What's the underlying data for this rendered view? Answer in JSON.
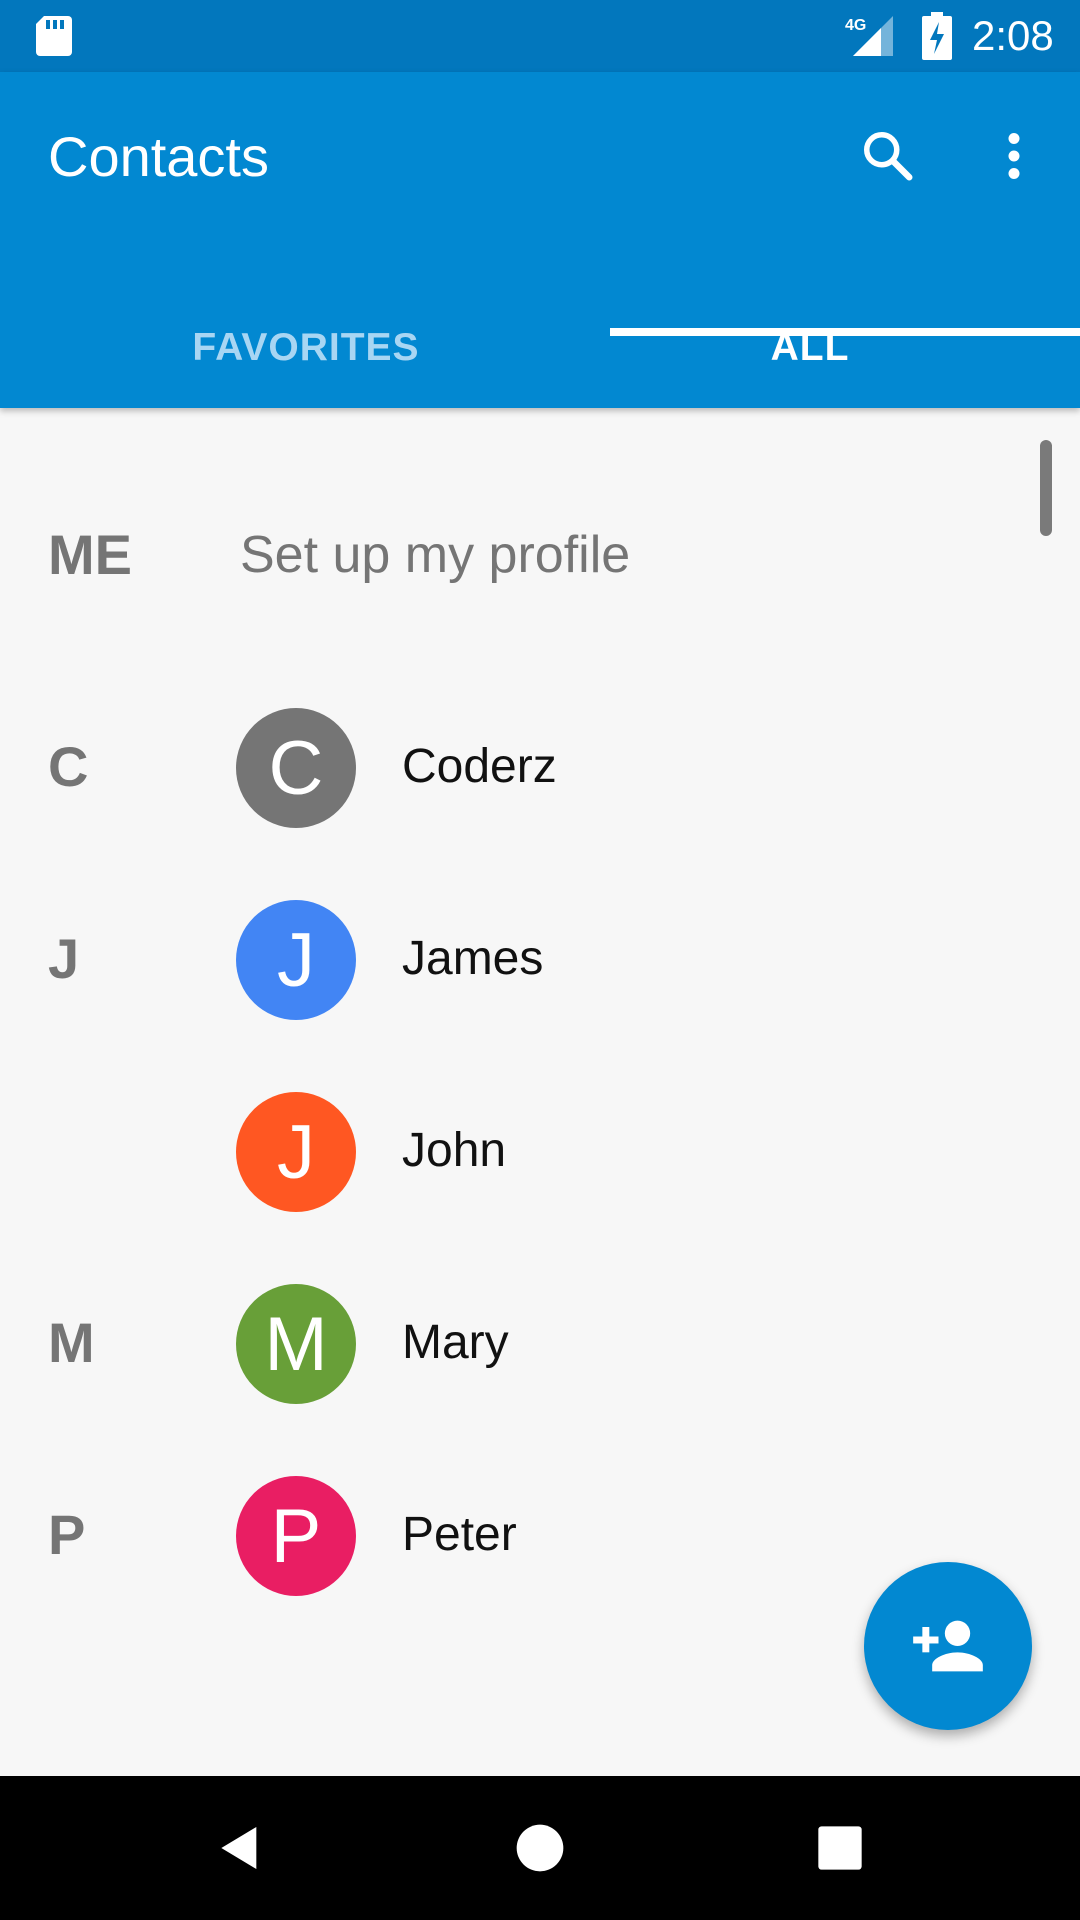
{
  "status_bar": {
    "network": "4G",
    "time": "2:08",
    "icons": [
      "sd-card-icon",
      "signal-icon",
      "battery-charging-icon"
    ]
  },
  "app_bar": {
    "title": "Contacts",
    "icons": [
      "search-icon",
      "more-vert-icon"
    ],
    "color": "#0288d1"
  },
  "tabs": [
    {
      "label": "FAVORITES",
      "selected": false
    },
    {
      "label": "ALL",
      "selected": true
    }
  ],
  "me": {
    "section": "ME",
    "label": "Set up my profile"
  },
  "contacts": [
    {
      "section": "C",
      "initial": "C",
      "name": "Coderz",
      "color": "#757575"
    },
    {
      "section": "J",
      "initial": "J",
      "name": "James",
      "color": "#4285f4"
    },
    {
      "section": "",
      "initial": "J",
      "name": "John",
      "color": "#ff5722"
    },
    {
      "section": "M",
      "initial": "M",
      "name": "Mary",
      "color": "#689f38"
    },
    {
      "section": "P",
      "initial": "P",
      "name": "Peter",
      "color": "#e91e63"
    }
  ],
  "fab": {
    "icon": "add-person-icon"
  },
  "nav": {
    "icons": [
      "back-icon",
      "home-icon",
      "recent-apps-icon"
    ]
  }
}
